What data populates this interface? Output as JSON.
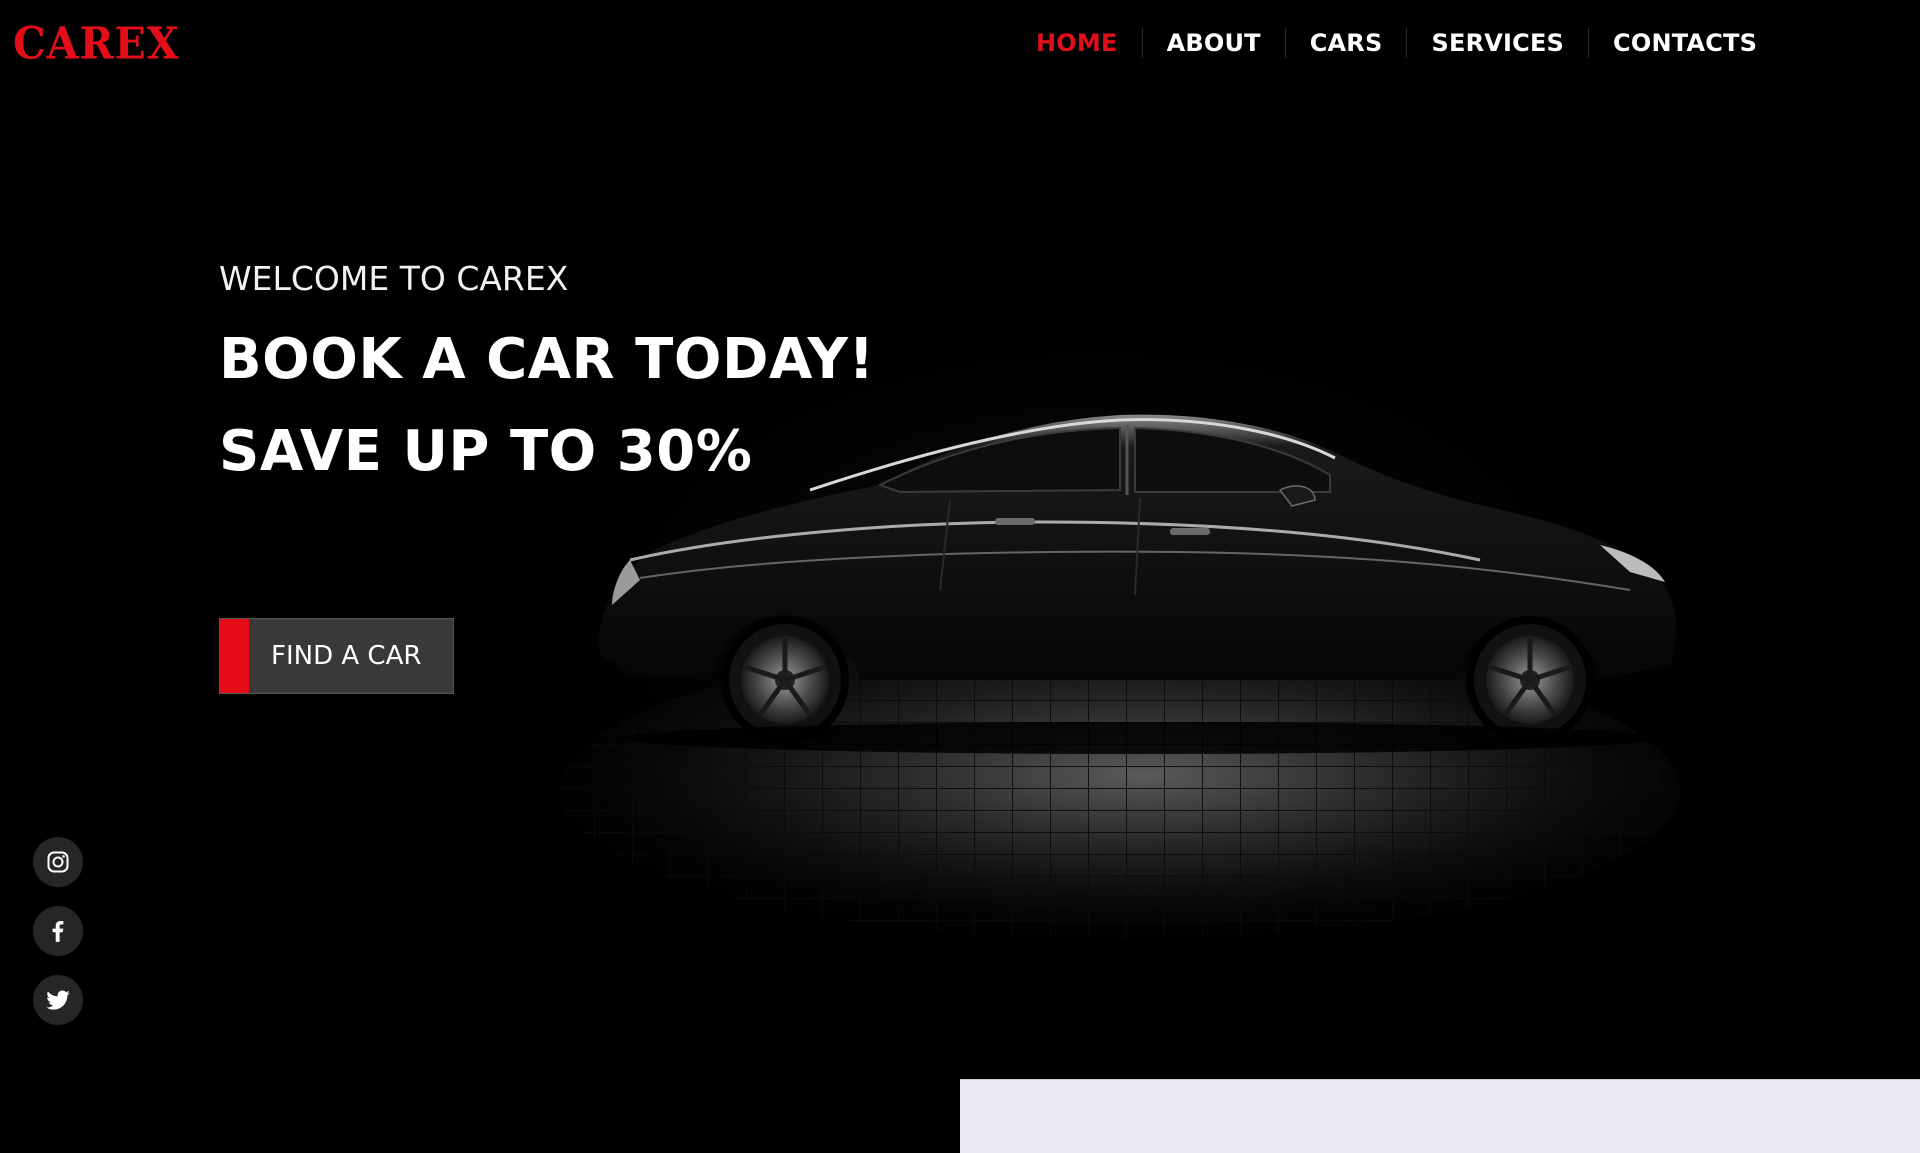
{
  "brand": {
    "logo_text": "CAREX",
    "accent_color": "#e50d1a"
  },
  "nav": {
    "active_color": "#e0101a",
    "items": [
      {
        "label": "HOME",
        "active": true
      },
      {
        "label": "ABOUT",
        "active": false
      },
      {
        "label": "CARS",
        "active": false
      },
      {
        "label": "SERVICES",
        "active": false
      },
      {
        "label": "CONTACTS",
        "active": false
      }
    ]
  },
  "hero": {
    "welcome": "WELCOME TO CAREX",
    "headline_1": "BOOK A CAR TODAY!",
    "headline_2": "SAVE UP TO 30%",
    "cta_label": "FIND A CAR"
  },
  "social": {
    "icons": [
      "instagram-icon",
      "facebook-icon",
      "twitter-icon"
    ]
  },
  "colors": {
    "background": "#000000",
    "button_bg": "#3a3839",
    "next_section_bg": "#e8e9f3"
  }
}
